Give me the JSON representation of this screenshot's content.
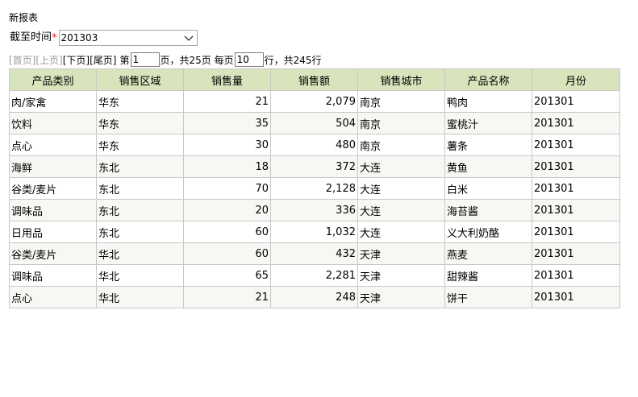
{
  "report": {
    "title": "新报表"
  },
  "filter": {
    "label": "截至时间",
    "required_mark": "*",
    "selected_value": "201303"
  },
  "pager": {
    "first": "[首页]",
    "prev": "[上页]",
    "next": "[下页]",
    "last": "[尾页]",
    "page_prefix": "第",
    "current_page": "1",
    "page_suffix": "页，共25页 每页",
    "page_size": "10",
    "total_suffix": "行，共245行"
  },
  "table": {
    "columns": [
      "产品类别",
      "销售区域",
      "销售量",
      "销售额",
      "销售城市",
      "产品名称",
      "月份"
    ],
    "rows": [
      [
        "肉/家禽",
        "华东",
        "21",
        "2,079",
        "南京",
        "鸭肉",
        "201301"
      ],
      [
        "饮料",
        "华东",
        "35",
        "504",
        "南京",
        "蜜桃汁",
        "201301"
      ],
      [
        "点心",
        "华东",
        "30",
        "480",
        "南京",
        "薯条",
        "201301"
      ],
      [
        "海鲜",
        "东北",
        "18",
        "372",
        "大连",
        "黄鱼",
        "201301"
      ],
      [
        "谷类/麦片",
        "东北",
        "70",
        "2,128",
        "大连",
        "白米",
        "201301"
      ],
      [
        "调味品",
        "东北",
        "20",
        "336",
        "大连",
        "海苔酱",
        "201301"
      ],
      [
        "日用品",
        "东北",
        "60",
        "1,032",
        "大连",
        "义大利奶酪",
        "201301"
      ],
      [
        "谷类/麦片",
        "华北",
        "60",
        "432",
        "天津",
        "燕麦",
        "201301"
      ],
      [
        "调味品",
        "华北",
        "65",
        "2,281",
        "天津",
        "甜辣酱",
        "201301"
      ],
      [
        "点心",
        "华北",
        "21",
        "248",
        "天津",
        "饼干",
        "201301"
      ]
    ]
  },
  "colors": {
    "header_bg": "#d8e4bc",
    "required_star": "#e02020",
    "disabled_link": "#999999"
  },
  "icons": {
    "dropdown": "chevron-down-icon"
  }
}
